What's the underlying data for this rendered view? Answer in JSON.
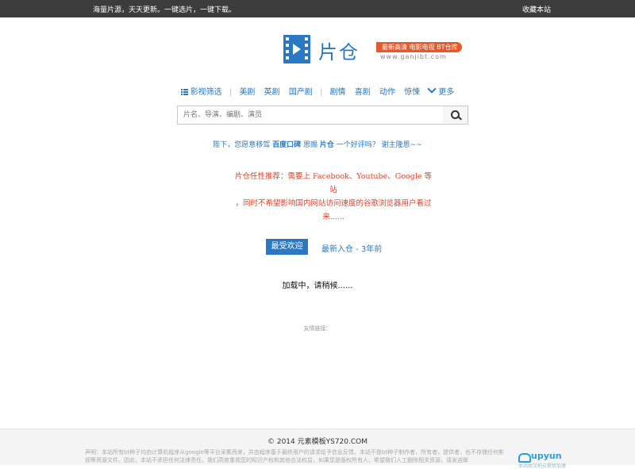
{
  "topbar": {
    "slogan": "海量片源，天天更新。一键选片，一键下载。",
    "bookmark": "收藏本站"
  },
  "logo": {
    "name": "片仓",
    "slogan": "最新高清 电影电视 BT仓库",
    "url": "www.ganjibt.com"
  },
  "nav": {
    "items": [
      "影视筛选",
      "美剧",
      "英剧",
      "国产剧",
      "剧情",
      "喜剧",
      "动作",
      "惊悚",
      "更多"
    ]
  },
  "search": {
    "placeholder": "片名、导演、编剧、演员"
  },
  "notice": {
    "prefix": "陛下，您愿意移驾",
    "site1": "百度口碑",
    "mid": "恩赐",
    "site2": "片仓",
    "suffix": "一个好评吗？ 谢主隆恩~~"
  },
  "recommendation": {
    "line1": "片仓任性推荐：需要上 Facebook、Youtube、Google 等站",
    "line2": "，同时不希望影响国内网站访问速度的谷歌浏览器用户看过",
    "line3": "来......"
  },
  "tabs": {
    "active": "最受欢迎",
    "other": "最新入仓 - 3年前"
  },
  "loading": "加载中，请稍候......",
  "friend_links": "友情链接：",
  "footer": {
    "copyright": "© 2014 元素模板YS720.COM",
    "disclaimer": "声明：本站所有bt种子均由计算机程序从google等平台采集而来，并由程序基于最终用户的请求给予信息反馈。本站不是bt种子制作者，所有者，提供者，也不存储任何影视等资源文件。因此，本站不承担任何法律责任。我们高度重视您的知识产权和其他合法权益，如果您是版权所有人，希望我们人工删除相关资源，请发送邮",
    "upyun": "upyun",
    "upyun_sub": "本站由又拍云提供加速"
  },
  "colors": {
    "accent": "#2a78c2",
    "topbar": "#3c3c3c",
    "highlight": "#e0402a",
    "logo_tag": "#e5592a"
  }
}
